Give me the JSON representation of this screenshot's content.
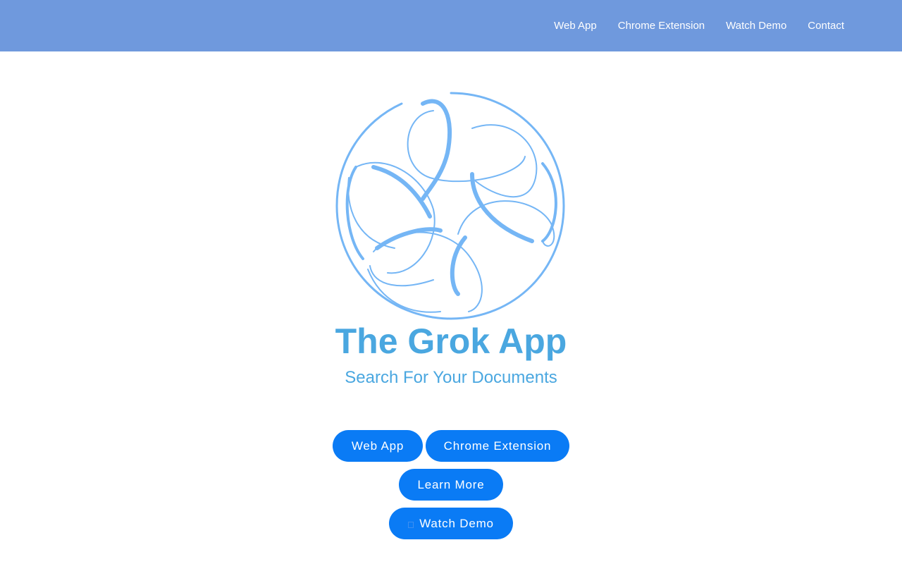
{
  "nav": {
    "links": [
      {
        "label": "Web App"
      },
      {
        "label": "Chrome Extension"
      },
      {
        "label": "Watch Demo"
      },
      {
        "label": "Contact"
      }
    ]
  },
  "hero": {
    "title": "The Grok App",
    "subtitle": "Search For Your Documents",
    "buttons": {
      "web_app": "Web App",
      "chrome_extension": "Chrome Extension",
      "learn_more": "Learn More",
      "watch_demo": "Watch Demo"
    }
  },
  "colors": {
    "navbar": "#6f99dd",
    "accent": "#4aa7e0",
    "button": "#0a7bf5",
    "logo": "#75b6f5"
  },
  "icons": {
    "logo": "swirl-circle-logo",
    "watch_demo": "play-icon"
  }
}
